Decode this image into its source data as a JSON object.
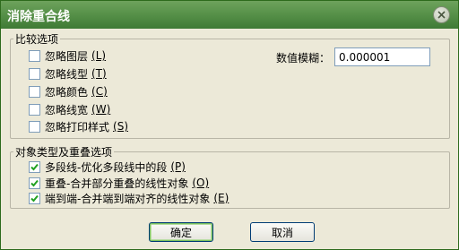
{
  "window": {
    "title": "消除重合线"
  },
  "compare": {
    "legend": "比较选项",
    "options": [
      {
        "label": "忽略图层",
        "hotkey": "(L)",
        "checked": false
      },
      {
        "label": "忽略线型",
        "hotkey": "(T)",
        "checked": false
      },
      {
        "label": "忽略颜色",
        "hotkey": "(C)",
        "checked": false
      },
      {
        "label": "忽略线宽",
        "hotkey": "(W)",
        "checked": false
      },
      {
        "label": "忽略打印样式",
        "hotkey": "(S)",
        "checked": false
      }
    ],
    "tolerance_label": "数值模糊：",
    "tolerance_value": "0.000001"
  },
  "objects": {
    "legend": "对象类型及重叠选项",
    "options": [
      {
        "label": "多段线-优化多段线中的段",
        "hotkey": "(P)",
        "checked": true
      },
      {
        "label": "重叠-合并部分重叠的线性对象",
        "hotkey": "(O)",
        "checked": true
      },
      {
        "label": "端到端-合并端到端对齐的线性对象",
        "hotkey": "(E)",
        "checked": true
      }
    ]
  },
  "buttons": {
    "ok": "确定",
    "cancel": "取消"
  }
}
